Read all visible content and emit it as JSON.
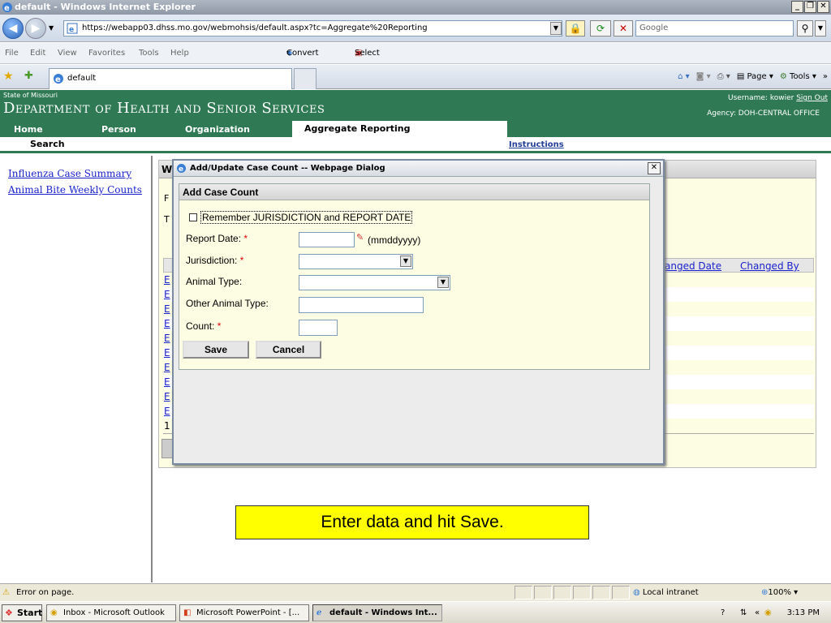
{
  "window": {
    "title": "default - Windows Internet Explorer"
  },
  "browser": {
    "url": "https://webapp03.dhss.mo.gov/webmohsis/default.aspx?tc=Aggregate%20Reporting",
    "search_placeholder": "Google",
    "menu": [
      "File",
      "Edit",
      "View",
      "Favorites",
      "Tools",
      "Help"
    ],
    "convert_label": "Convert",
    "select_label": "Select",
    "tab_title": "default",
    "commands": {
      "page": "Page",
      "tools": "Tools"
    }
  },
  "site": {
    "state": "State of Missouri",
    "department": "Department of Health and Senior Services",
    "username_label": "Username:",
    "username": "kowier",
    "sign_out": "Sign Out",
    "agency_label": "Agency:",
    "agency": "DOH-CENTRAL OFFICE",
    "nav": [
      "Home",
      "Person",
      "Organization",
      "Aggregate Reporting"
    ],
    "subnav_search": "Search",
    "instructions": "Instructions"
  },
  "leftnav": [
    "Influenza Case Summary",
    "Animal Bite Weekly Counts"
  ],
  "main": {
    "header_letter": "W",
    "peek_f": "F",
    "peek_t": "T",
    "col_changed_date": "anged Date",
    "col_changed_by": "Changed By",
    "row_links": [
      "E",
      "E",
      "E",
      "E",
      "E",
      "E",
      "E",
      "E",
      "E",
      "E"
    ],
    "page_number": "1"
  },
  "dialog": {
    "title": "Add/Update Case Count -- Webpage Dialog",
    "section": "Add Case Count",
    "remember_label": "Remember JURISDICTION and REPORT DATE",
    "report_date_label": "Report Date:",
    "date_hint": "(mmddyyyy)",
    "jurisdiction_label": "Jurisdiction:",
    "animal_type_label": "Animal Type:",
    "other_animal_label": "Other Animal Type:",
    "count_label": "Count:",
    "required_mark": "*",
    "save": "Save",
    "cancel": "Cancel",
    "values": {
      "report_date": "",
      "jurisdiction": "",
      "animal_type": "",
      "other_animal": "",
      "count": ""
    }
  },
  "note": "Enter data and hit Save.",
  "statusbar": {
    "text": "Error on page.",
    "zone": "Local intranet",
    "zoom": "100%"
  },
  "taskbar": {
    "start": "Start",
    "items": [
      "Inbox - Microsoft Outlook",
      "Microsoft PowerPoint - [...",
      "default - Windows Int..."
    ],
    "clock": "3:13 PM"
  },
  "colors": {
    "header_green": "#2f7a54",
    "note_yellow": "#ffff00",
    "panel_cream": "#fdfde4",
    "link_blue": "#1a22cc"
  }
}
